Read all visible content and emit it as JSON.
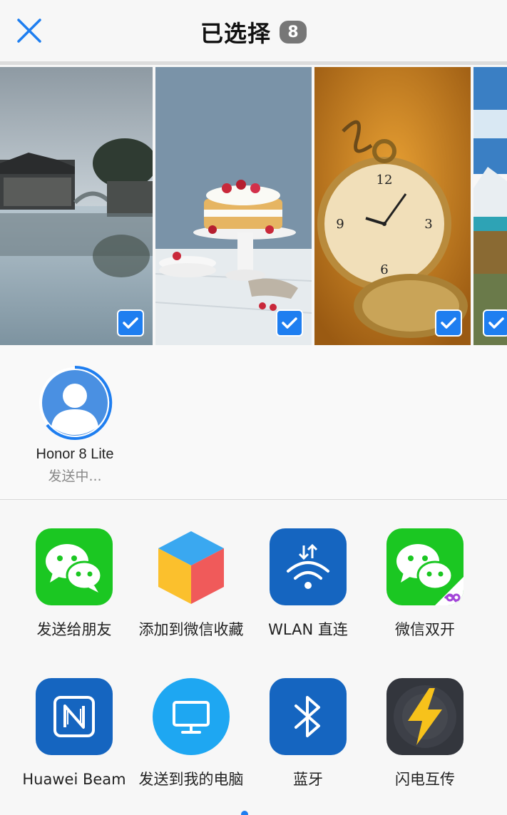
{
  "header": {
    "title": "已选择",
    "selected_count": "8",
    "close_icon": "close-icon"
  },
  "photos": [
    {
      "name": "water-town",
      "selected": true
    },
    {
      "name": "strawberry-cake",
      "selected": true
    },
    {
      "name": "pocket-watch",
      "selected": true
    },
    {
      "name": "mountain-lake",
      "selected": true
    }
  ],
  "device": {
    "name": "Honor 8 Lite",
    "status": "发送中..."
  },
  "apps": [
    {
      "label": "发送给朋友",
      "icon": "wechat-icon"
    },
    {
      "label": "添加到微信收藏",
      "icon": "wechat-favorites-icon"
    },
    {
      "label": "WLAN 直连",
      "icon": "wlan-direct-icon"
    },
    {
      "label": "微信双开",
      "icon": "wechat-dual-icon"
    },
    {
      "label": "Huawei Beam",
      "icon": "nfc-beam-icon"
    },
    {
      "label": "发送到我的电脑",
      "icon": "monitor-icon"
    },
    {
      "label": "蓝牙",
      "icon": "bluetooth-icon"
    },
    {
      "label": "闪电互传",
      "icon": "lightning-icon"
    }
  ],
  "colors": {
    "accent": "#1e7ef0",
    "wechat_green": "#1bc722",
    "badge_gray": "#777777"
  }
}
